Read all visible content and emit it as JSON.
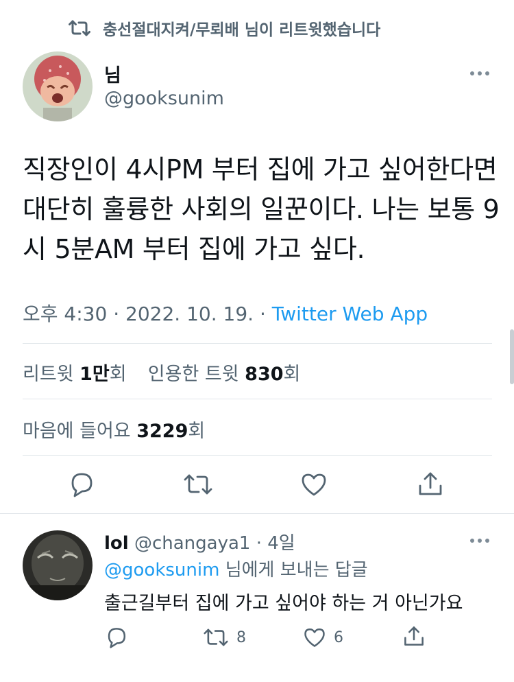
{
  "retweet_banner": {
    "text": "충선절대지켜/무뢰배 님이 리트윗했습니다",
    "icon": "retweet-icon"
  },
  "tweet": {
    "author_name": "님",
    "author_handle": "@gooksunim",
    "text": "직장인이 4시PM 부터 집에 가고 싶어한다면 대단히 훌륭한 사회의 일꾼이다. 나는 보통 9시 5분AM 부터 집에 가고 싶다.",
    "time": "오후 4:30",
    "sep1": " · ",
    "date": "2022. 10. 19.",
    "sep2": " · ",
    "source": "Twitter Web App"
  },
  "stats": {
    "retweets_label": "리트윗 ",
    "retweets_value": "1만",
    "retweets_suffix": "회",
    "quotes_label": "인용한 트윗 ",
    "quotes_value": "830",
    "quotes_suffix": "회",
    "likes_label": "마음에 들어요 ",
    "likes_value": "3229",
    "likes_suffix": "회"
  },
  "actions": [
    "reply-icon",
    "retweet-icon",
    "like-icon",
    "share-icon"
  ],
  "reply": {
    "author_name": "lol",
    "author_handle": "@changaya1",
    "sep": " · ",
    "age": "4일",
    "replying_to_handle": "@gooksunim",
    "replying_to_suffix": " 님에게 보내는 답글",
    "text": "출근길부터 집에 가고 싶어야 하는 거 아닌가요",
    "retweet_count": "8",
    "like_count": "6"
  },
  "colors": {
    "accent": "#1d9bf0",
    "muted": "#536471",
    "text": "#0f1419",
    "divider": "#e1e6ea"
  }
}
